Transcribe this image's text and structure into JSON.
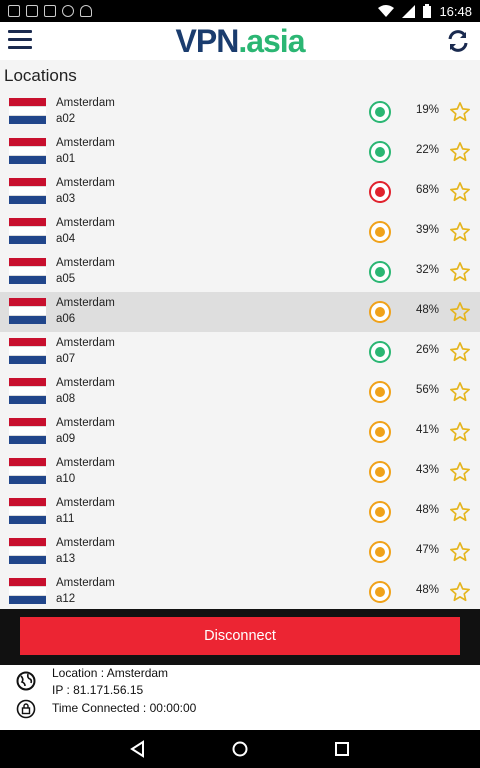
{
  "status": {
    "time": "16:48"
  },
  "app": {
    "logo_vpn": "VPN",
    "logo_dot": ".",
    "logo_asia": "asia"
  },
  "section_title": "Locations",
  "colors": {
    "good": "#2bb673",
    "medium": "#f0a21a",
    "bad": "#e0222d",
    "star": "#e5b51e",
    "disconnect": "#ec2533"
  },
  "servers": [
    {
      "city": "Amsterdam",
      "server": "a02",
      "status": "good",
      "load": "19%"
    },
    {
      "city": "Amsterdam",
      "server": "a01",
      "status": "good",
      "load": "22%"
    },
    {
      "city": "Amsterdam",
      "server": "a03",
      "status": "bad",
      "load": "68%"
    },
    {
      "city": "Amsterdam",
      "server": "a04",
      "status": "medium",
      "load": "39%"
    },
    {
      "city": "Amsterdam",
      "server": "a05",
      "status": "good",
      "load": "32%"
    },
    {
      "city": "Amsterdam",
      "server": "a06",
      "status": "medium",
      "load": "48%",
      "selected": true
    },
    {
      "city": "Amsterdam",
      "server": "a07",
      "status": "good",
      "load": "26%"
    },
    {
      "city": "Amsterdam",
      "server": "a08",
      "status": "medium",
      "load": "56%"
    },
    {
      "city": "Amsterdam",
      "server": "a09",
      "status": "medium",
      "load": "41%"
    },
    {
      "city": "Amsterdam",
      "server": "a10",
      "status": "medium",
      "load": "43%"
    },
    {
      "city": "Amsterdam",
      "server": "a11",
      "status": "medium",
      "load": "48%"
    },
    {
      "city": "Amsterdam",
      "server": "a13",
      "status": "medium",
      "load": "47%"
    },
    {
      "city": "Amsterdam",
      "server": "a12",
      "status": "medium",
      "load": "48%"
    }
  ],
  "disconnect_label": "Disconnect",
  "connection": {
    "location": "Location : Amsterdam",
    "ip": "IP : 81.171.56.15",
    "time_connected": "Time Connected : 00:00:00"
  }
}
